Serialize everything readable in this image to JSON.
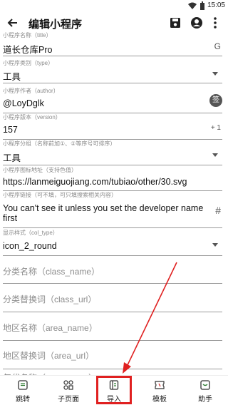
{
  "status": {
    "time": "15:05"
  },
  "toolbar": {
    "title": "编辑小程序",
    "back_icon": "arrow-left-icon",
    "save_icon": "save-icon",
    "account_icon": "account-circle-icon",
    "more_icon": "more-vertical-icon"
  },
  "fields": {
    "name": {
      "label": "小程序名称（title）",
      "value": "道长仓库Pro",
      "side": "G"
    },
    "type": {
      "label": "小程序类别（type）",
      "value": "工具"
    },
    "author": {
      "label": "小程序作者（author）",
      "value": "@LoyDglk",
      "side": "签"
    },
    "version": {
      "label": "小程序版本（version）",
      "value": "157",
      "side": "+ 1"
    },
    "group": {
      "label": "小程序分组（名称前加①、②等序号可排序）",
      "value": "工具"
    },
    "icon": {
      "label": "小程序图标地址（支持色值）",
      "value": "https://lanmeiguojiang.com/tubiao/other/30.svg"
    },
    "link": {
      "label": "小程序链接（可不填，可只填搜索相关内容）",
      "value_line1": "You can't see it unless you set the developer name",
      "value_line2": "first",
      "side": "#"
    },
    "col_type": {
      "label": "显示样式（col_type）",
      "value": "icon_2_round"
    },
    "class_name": {
      "placeholder": "分类名称（class_name）"
    },
    "class_url": {
      "placeholder": "分类替换词（class_url）"
    },
    "area_name": {
      "placeholder": "地区名称（area_name）"
    },
    "area_url": {
      "placeholder": "地区替换词（area_url）"
    },
    "year_name": {
      "placeholder": "年代名称（year_name）"
    }
  },
  "bottom_nav": [
    {
      "label": "跳转",
      "icon": "jump-icon"
    },
    {
      "label": "子页面",
      "icon": "subpage-grid-icon"
    },
    {
      "label": "导入",
      "icon": "import-book-icon"
    },
    {
      "label": "模板",
      "icon": "template-icon"
    },
    {
      "label": "助手",
      "icon": "assistant-icon"
    }
  ],
  "colors": {
    "annotation_red": "#e02020",
    "nav_icon_green": "#2e7d32"
  }
}
